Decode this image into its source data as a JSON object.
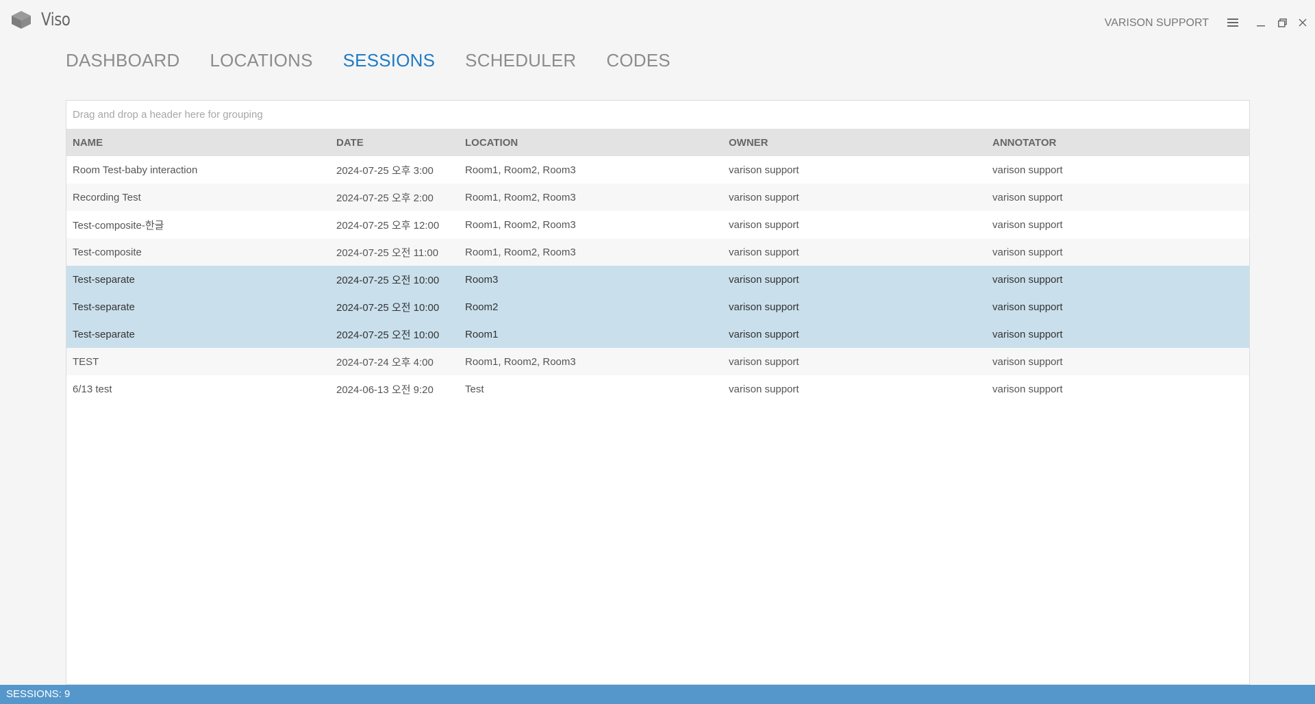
{
  "app": {
    "name": "Viso",
    "user": "VARISON SUPPORT",
    "logo_icon": "cube-icon"
  },
  "nav": {
    "tabs": [
      {
        "label": "DASHBOARD",
        "active": false
      },
      {
        "label": "LOCATIONS",
        "active": false
      },
      {
        "label": "SESSIONS",
        "active": true
      },
      {
        "label": "SCHEDULER",
        "active": false
      },
      {
        "label": "CODES",
        "active": false
      }
    ]
  },
  "grid": {
    "group_placeholder": "Drag and drop a header here for grouping",
    "columns": [
      "NAME",
      "DATE",
      "LOCATION",
      "OWNER",
      "ANNOTATOR"
    ],
    "rows": [
      {
        "name": "Room Test-baby interaction",
        "date": "2024-07-25 오후 3:00",
        "location": "Room1, Room2, Room3",
        "owner": "varison support",
        "annotator": "varison support",
        "selected": false
      },
      {
        "name": "Recording Test",
        "date": "2024-07-25 오후 2:00",
        "location": "Room1, Room2, Room3",
        "owner": "varison support",
        "annotator": "varison support",
        "selected": false
      },
      {
        "name": "Test-composite-한글",
        "date": "2024-07-25 오후 12:00",
        "location": "Room1, Room2, Room3",
        "owner": "varison support",
        "annotator": "varison support",
        "selected": false
      },
      {
        "name": "Test-composite",
        "date": "2024-07-25 오전 11:00",
        "location": "Room1, Room2, Room3",
        "owner": "varison support",
        "annotator": "varison support",
        "selected": false
      },
      {
        "name": "Test-separate",
        "date": "2024-07-25 오전 10:00",
        "location": "Room3",
        "owner": "varison support",
        "annotator": "varison support",
        "selected": true
      },
      {
        "name": "Test-separate",
        "date": "2024-07-25 오전 10:00",
        "location": "Room2",
        "owner": "varison support",
        "annotator": "varison support",
        "selected": true
      },
      {
        "name": "Test-separate",
        "date": "2024-07-25 오전 10:00",
        "location": "Room1",
        "owner": "varison support",
        "annotator": "varison support",
        "selected": true
      },
      {
        "name": "TEST",
        "date": "2024-07-24 오후 4:00",
        "location": "Room1, Room2, Room3",
        "owner": "varison support",
        "annotator": "varison support",
        "selected": false
      },
      {
        "name": "6/13 test",
        "date": "2024-06-13 오전 9:20",
        "location": "Test",
        "owner": "varison support",
        "annotator": "varison support",
        "selected": false
      }
    ]
  },
  "status": {
    "text": "SESSIONS: 9"
  },
  "colors": {
    "accent": "#1e7bc6",
    "selected_row": "#c9dfec",
    "status_bar": "#5597cb",
    "header_bg": "#e3e3e3"
  }
}
